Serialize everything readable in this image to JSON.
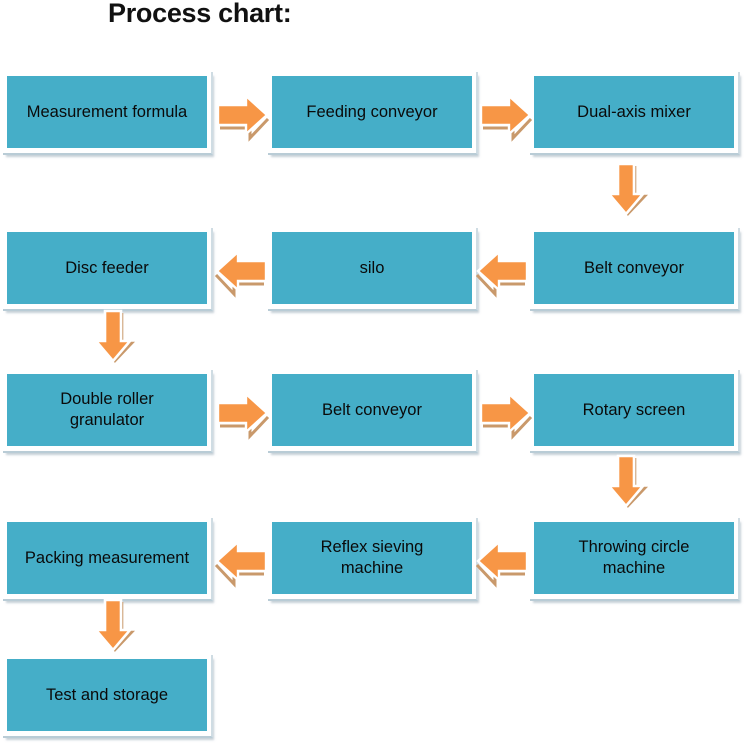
{
  "title": "Process chart:",
  "colors": {
    "node_fill": "#45AEC8",
    "node_border": "#C3D4DD",
    "arrow_fill": "#F79646",
    "arrow_shadow": "#C9996B",
    "arrow_outline": "#FFFFFF",
    "text": "#0A0A0A",
    "background": "#FFFFFF"
  },
  "chart_data": {
    "type": "diagram",
    "title": "Process chart:",
    "diagram_type": "flowchart",
    "flow_direction": "boustrophedon (serpentine: left-to-right, then right-to-left)",
    "grid": {
      "columns": 3,
      "rows": 5
    },
    "nodes": [
      {
        "id": "n1",
        "label": "Measurement formula",
        "row": 1,
        "col": 1
      },
      {
        "id": "n2",
        "label": "Feeding conveyor",
        "row": 1,
        "col": 2
      },
      {
        "id": "n3",
        "label": "Dual-axis mixer",
        "row": 1,
        "col": 3
      },
      {
        "id": "n4",
        "label": "Belt conveyor",
        "row": 2,
        "col": 3
      },
      {
        "id": "n5",
        "label": "silo",
        "row": 2,
        "col": 2
      },
      {
        "id": "n6",
        "label": "Disc feeder",
        "row": 2,
        "col": 1
      },
      {
        "id": "n7",
        "label": "Double roller\ngranulator",
        "row": 3,
        "col": 1
      },
      {
        "id": "n8",
        "label": "Belt conveyor",
        "row": 3,
        "col": 2
      },
      {
        "id": "n9",
        "label": "Rotary screen",
        "row": 3,
        "col": 3
      },
      {
        "id": "n10",
        "label": "Throwing circle\nmachine",
        "row": 4,
        "col": 3
      },
      {
        "id": "n11",
        "label": "Reflex sieving\nmachine",
        "row": 4,
        "col": 2
      },
      {
        "id": "n12",
        "label": "Packing measurement",
        "row": 4,
        "col": 1
      },
      {
        "id": "n13",
        "label": "Test and storage",
        "row": 5,
        "col": 1
      }
    ],
    "edges": [
      {
        "from": "n1",
        "to": "n2",
        "direction": "right"
      },
      {
        "from": "n2",
        "to": "n3",
        "direction": "right"
      },
      {
        "from": "n3",
        "to": "n4",
        "direction": "down"
      },
      {
        "from": "n4",
        "to": "n5",
        "direction": "left"
      },
      {
        "from": "n5",
        "to": "n6",
        "direction": "left"
      },
      {
        "from": "n6",
        "to": "n7",
        "direction": "down"
      },
      {
        "from": "n7",
        "to": "n8",
        "direction": "right"
      },
      {
        "from": "n8",
        "to": "n9",
        "direction": "right"
      },
      {
        "from": "n9",
        "to": "n10",
        "direction": "down"
      },
      {
        "from": "n10",
        "to": "n11",
        "direction": "left"
      },
      {
        "from": "n11",
        "to": "n12",
        "direction": "left"
      },
      {
        "from": "n12",
        "to": "n13",
        "direction": "down"
      }
    ]
  },
  "nodes": {
    "n1": {
      "label": "Measurement formula"
    },
    "n2": {
      "label": "Feeding conveyor"
    },
    "n3": {
      "label": "Dual-axis mixer"
    },
    "n4": {
      "label": "Belt conveyor"
    },
    "n5": {
      "label": "silo"
    },
    "n6": {
      "label": "Disc feeder"
    },
    "n7": {
      "label": "Double roller\ngranulator"
    },
    "n8": {
      "label": "Belt conveyor"
    },
    "n9": {
      "label": "Rotary screen"
    },
    "n10": {
      "label": "Throwing circle\nmachine"
    },
    "n11": {
      "label": "Reflex sieving\nmachine"
    },
    "n12": {
      "label": "Packing measurement"
    },
    "n13": {
      "label": "Test and storage"
    }
  },
  "arrows": {
    "a1": {
      "name": "arrow-right-measurement-to-feeding"
    },
    "a2": {
      "name": "arrow-right-feeding-to-mixer"
    },
    "a3": {
      "name": "arrow-down-mixer-to-belt"
    },
    "a4": {
      "name": "arrow-left-belt-to-silo"
    },
    "a5": {
      "name": "arrow-left-silo-to-disc"
    },
    "a6": {
      "name": "arrow-down-disc-to-granulator"
    },
    "a7": {
      "name": "arrow-right-granulator-to-belt"
    },
    "a8": {
      "name": "arrow-right-belt-to-rotary"
    },
    "a9": {
      "name": "arrow-down-rotary-to-throwing"
    },
    "a10": {
      "name": "arrow-left-throwing-to-reflex"
    },
    "a11": {
      "name": "arrow-left-reflex-to-packing"
    },
    "a12": {
      "name": "arrow-down-packing-to-test"
    }
  }
}
